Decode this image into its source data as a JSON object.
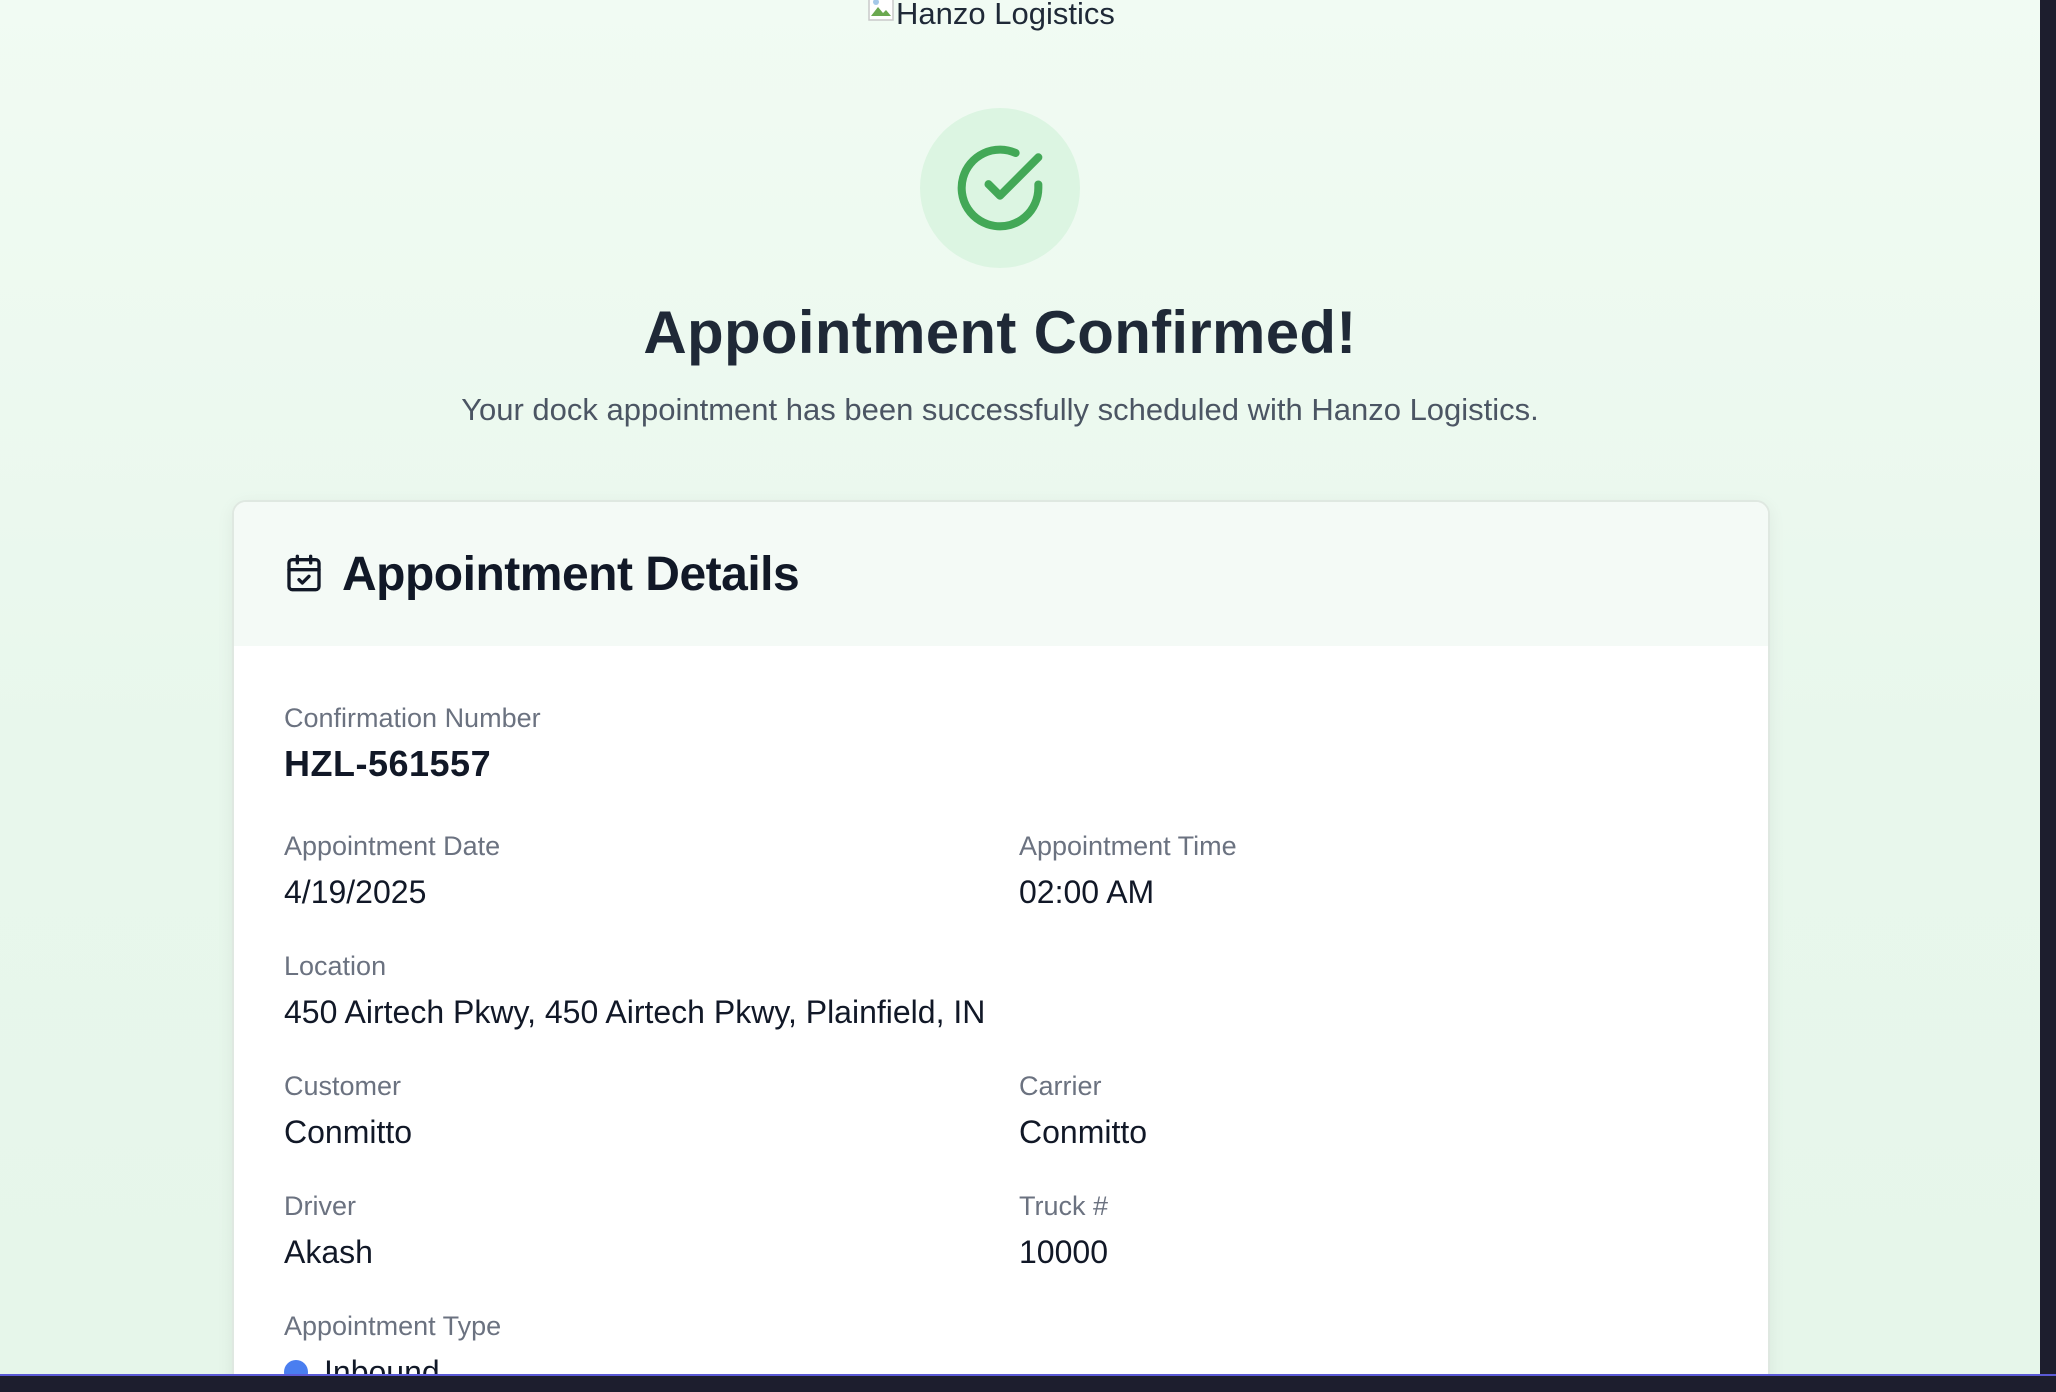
{
  "brand": {
    "logo_alt": "Hanzo Logistics"
  },
  "confirmation": {
    "title": "Appointment Confirmed!",
    "subtitle": "Your dock appointment has been successfully scheduled with Hanzo Logistics.",
    "icon": "check-circle-icon",
    "accent_color": "#43a857"
  },
  "details": {
    "header": "Appointment Details",
    "header_icon": "calendar-check-icon",
    "confirmation_number": {
      "label": "Confirmation Number",
      "value": "HZL-561557"
    },
    "date": {
      "label": "Appointment Date",
      "value": "4/19/2025"
    },
    "time": {
      "label": "Appointment Time",
      "value": "02:00 AM"
    },
    "location": {
      "label": "Location",
      "value": "450 Airtech Pkwy, 450 Airtech Pkwy, Plainfield, IN"
    },
    "customer": {
      "label": "Customer",
      "value": "Conmitto"
    },
    "carrier": {
      "label": "Carrier",
      "value": "Conmitto"
    },
    "driver": {
      "label": "Driver",
      "value": "Akash"
    },
    "truck": {
      "label": "Truck #",
      "value": "10000"
    },
    "type": {
      "label": "Appointment Type",
      "value": "Inbound",
      "dot_color": "#4a7ef0"
    }
  }
}
